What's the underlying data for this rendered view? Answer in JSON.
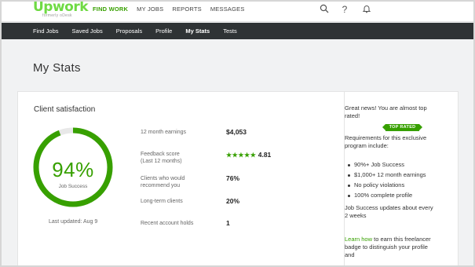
{
  "logo": {
    "text": "Upwork",
    "subtext": "formerly oDesk"
  },
  "topnav": [
    "FIND WORK",
    "MY JOBS",
    "REPORTS",
    "MESSAGES"
  ],
  "subnav": [
    "Find Jobs",
    "Saved Jobs",
    "Proposals",
    "Profile",
    "My Stats",
    "Tests"
  ],
  "page_title": "My Stats",
  "client_satisfaction": {
    "title": "Client satisfaction",
    "job_success_pct": 94,
    "job_success_text": "94%",
    "job_success_label": "Job Success",
    "last_updated": "Last updated: Aug 9"
  },
  "stats": [
    {
      "label": "12 month earnings",
      "value": "$4,053"
    },
    {
      "label": "Feedback score\n(Last 12 months)",
      "value": "4.81",
      "stars": "★★★★★"
    },
    {
      "label": "Clients who would\nrecommend you",
      "value": "76%"
    },
    {
      "label": "Long-term clients",
      "value": "20%"
    },
    {
      "label": "Recent account holds",
      "value": "1"
    }
  ],
  "sidebar": {
    "intro": "Great news! You are almost top rated!",
    "badge": "TOP RATED",
    "requirements_intro": "Requirements for this exclusive program include:",
    "requirements": [
      "90%+ Job Success",
      "$1,000+ 12 month earnings",
      "No policy violations",
      "100% complete profile"
    ],
    "update_note": "Job Success updates about every 2 weeks",
    "learn_link": "Learn how",
    "learn_rest": " to earn this freelancer badge to distinguish your profile and"
  },
  "colors": {
    "accent": "#37a000",
    "brand": "#6fda44",
    "nav_dark": "#2f3335",
    "ring_track": "#e8e8e8"
  },
  "icons": [
    "search-icon",
    "help-icon",
    "notification-bell-icon"
  ]
}
